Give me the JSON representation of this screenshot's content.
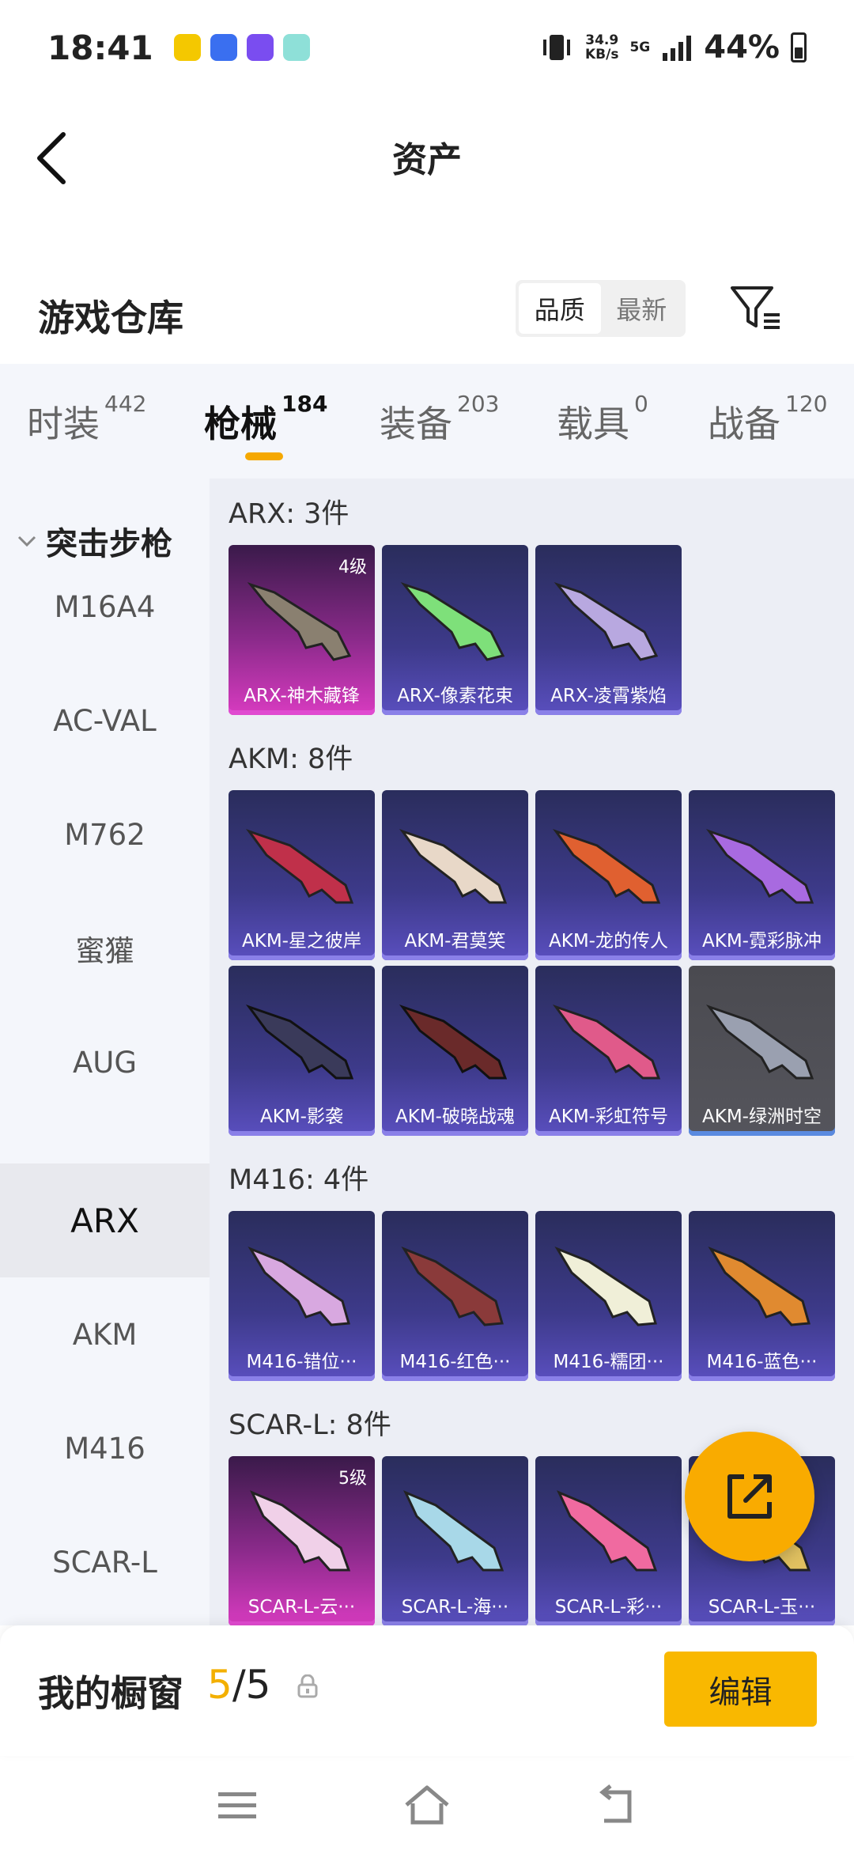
{
  "status": {
    "time": "18:41",
    "speed_top": "34.9",
    "speed_bottom": "KB/s",
    "net": "5G",
    "battery": "44%"
  },
  "header": {
    "title": "资产"
  },
  "warehouse": {
    "label": "游戏仓库",
    "sort_options": [
      "品质",
      "最新"
    ]
  },
  "tabs": [
    {
      "label": "时装",
      "count": "442"
    },
    {
      "label": "枪械",
      "count": "184"
    },
    {
      "label": "装备",
      "count": "203"
    },
    {
      "label": "载具",
      "count": "0"
    },
    {
      "label": "战备",
      "count": "120"
    }
  ],
  "sidebar": {
    "group": "突击步枪",
    "items": [
      "M16A4",
      "AC-VAL",
      "M762",
      "蜜獾",
      "AUG",
      "ARX",
      "AKM",
      "M416",
      "SCAR-L"
    ]
  },
  "sections": [
    {
      "title": "ARX: 3件",
      "cards": [
        {
          "name": "ARX-神木藏锋",
          "level": "4级"
        },
        {
          "name": "ARX-像素花束"
        },
        {
          "name": "ARX-凌霄紫焰"
        }
      ]
    },
    {
      "title": "AKM: 8件",
      "cards": [
        {
          "name": "AKM-星之彼岸"
        },
        {
          "name": "AKM-君莫笑"
        },
        {
          "name": "AKM-龙的传人"
        },
        {
          "name": "AKM-霓彩脉冲"
        },
        {
          "name": "AKM-影袭"
        },
        {
          "name": "AKM-破晓战魂"
        },
        {
          "name": "AKM-彩虹符号"
        },
        {
          "name": "AKM-绿洲时空"
        }
      ]
    },
    {
      "title": "M416: 4件",
      "cards": [
        {
          "name": "M416-错位···"
        },
        {
          "name": "M416-红色···"
        },
        {
          "name": "M416-糯团···"
        },
        {
          "name": "M416-蓝色···"
        }
      ]
    },
    {
      "title": "SCAR-L: 8件",
      "cards": [
        {
          "name": "SCAR-L-云···",
          "level": "5级"
        },
        {
          "name": "SCAR-L-海···"
        },
        {
          "name": "SCAR-L-彩···"
        },
        {
          "name": "SCAR-L-玉···"
        }
      ]
    }
  ],
  "bottom": {
    "label": "我的橱窗",
    "count_current": "5",
    "count_total": "/5",
    "edit_label": "编辑"
  },
  "colors": {
    "accent": "#f9b800",
    "tab_underline": "#f5a800"
  }
}
